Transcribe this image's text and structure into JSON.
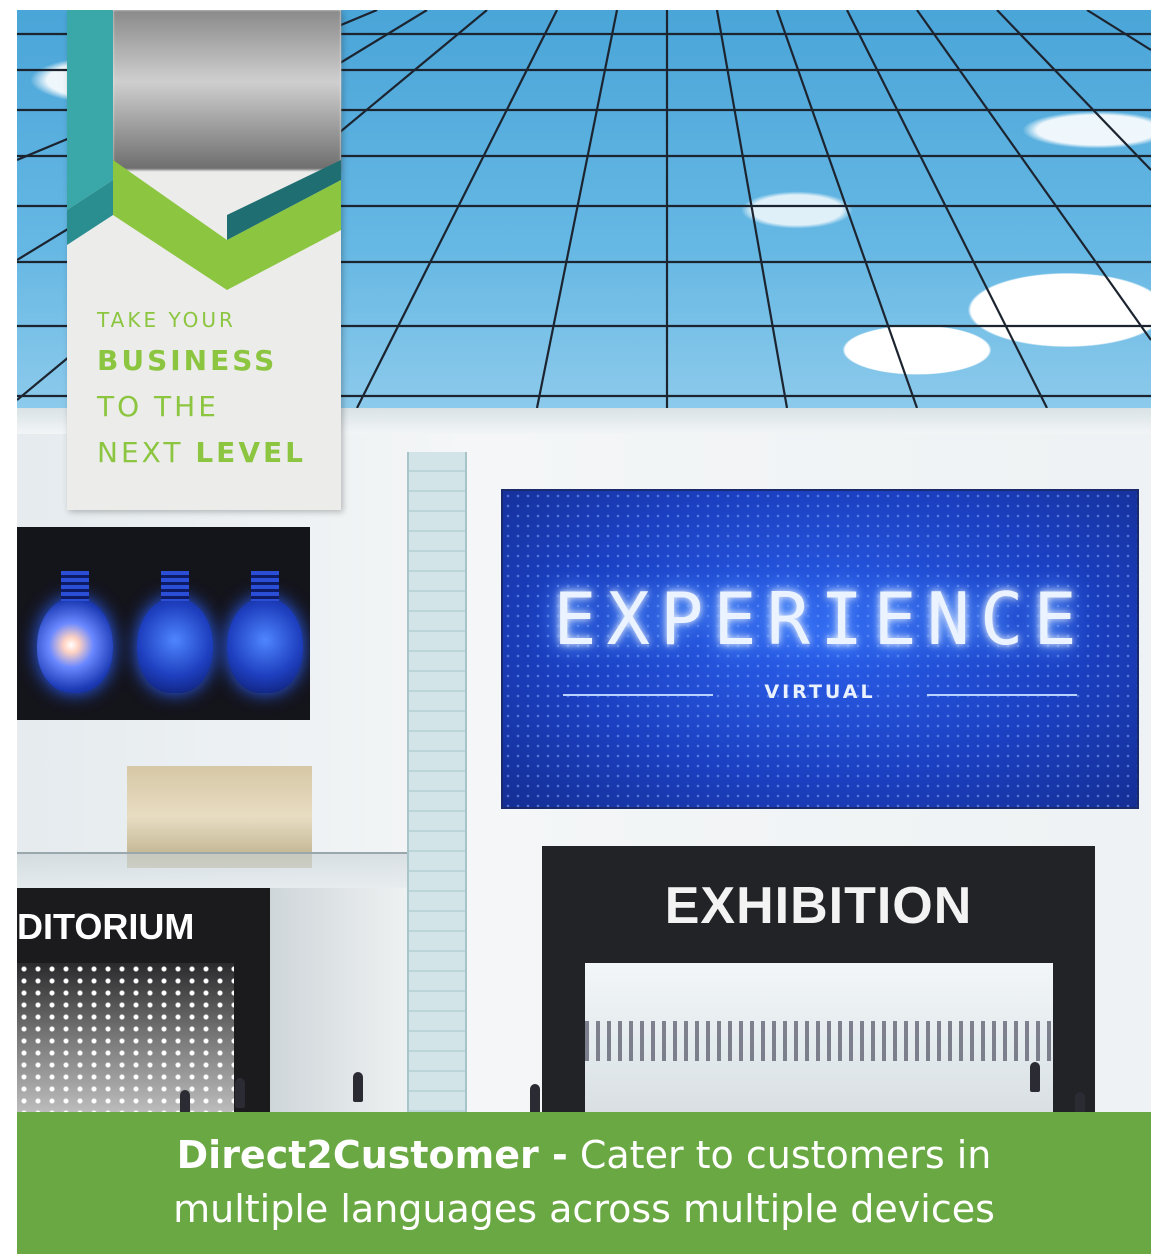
{
  "banner": {
    "line1": "TAKE YOUR",
    "line2": "BUSINESS",
    "line3": "TO THE",
    "line4_prefix": "NEXT ",
    "line4_emph": "LEVEL"
  },
  "screen": {
    "title": "EXPERIENCE",
    "subtitle": "VIRTUAL"
  },
  "signs": {
    "auditorium": "DITORIUM",
    "exhibition": "EXHIBITION"
  },
  "caption": {
    "brand": "Direct2Customer -",
    "line1_rest": " Cater to customers in",
    "line2": "multiple languages across multiple devices"
  },
  "colors": {
    "caption_bg": "#6aa843",
    "banner_green": "#8cc640",
    "screen_blue": "#1b3fc0"
  }
}
